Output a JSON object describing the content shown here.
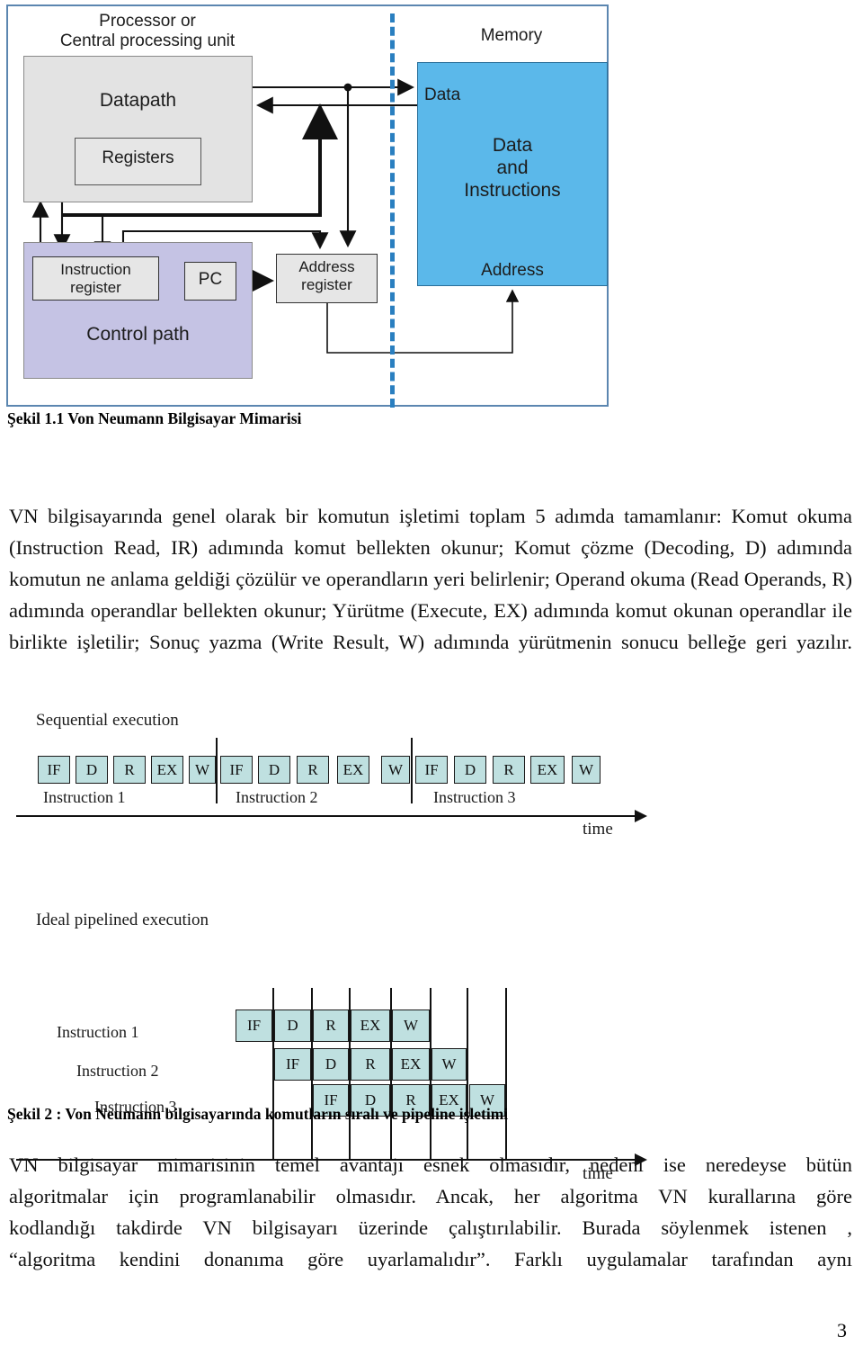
{
  "figure1": {
    "cpu_title": "Processor or\nCentral processing unit",
    "memory_title": "Memory",
    "datapath_label": "Datapath",
    "registers_label": "Registers",
    "control_path_label": "Control path",
    "instruction_register_label": "Instruction\nregister",
    "pc_label": "PC",
    "address_register_label": "Address\nregister",
    "memory_data_label": "Data",
    "memory_data_and_instructions_label": "Data\nand\nInstructions",
    "memory_address_label": "Address",
    "colors": {
      "frame_border": "#5b86b0",
      "datapath_fill": "#e3e3e3",
      "control_path_fill": "#c5c3e4",
      "memory_fill": "#5bb8ea",
      "divider": "#2a7fc0"
    },
    "caption": "Şekil 1.1 Von Neumann Bilgisayar Mimarisi"
  },
  "paragraph1": "VN bilgisayarında genel olarak bir komutun işletimi toplam 5 adımda tamamlanır: Komut okuma (Instruction Read, IR) adımında komut bellekten okunur;  Komut çözme (Decoding, D) adımında komutun ne anlama geldiği çözülür ve operandların yeri belirlenir; Operand okuma (Read Operands, R) adımında operandlar bellekten okunur; Yürütme (Execute, EX) adımında komut okunan operandlar ile birlikte işletilir; Sonuç yazma (Write Result, W) adımında yürütmenin sonucu belleğe geri yazılır.",
  "figure2": {
    "sequential_title": "Sequential execution",
    "pipelined_title": "Ideal pipelined execution",
    "time_label": "time",
    "stages": [
      "IF",
      "D",
      "R",
      "EX",
      "W"
    ],
    "instruction_labels": [
      "Instruction 1",
      "Instruction 2",
      "Instruction 3"
    ],
    "cell_color": "#bfe0e0",
    "caption": "Şekil 2 : Von Neumann bilgisayarında komutların sıralı ve pipeline işletimi"
  },
  "paragraph2": {
    "lines": [
      "VN  bilgisayar  mimarisinin  temel  avantajı  esnek  olmasıdır,  nedeni  ise  neredeyse  bütün",
      "algoritmalar  için  programlanabilir  olmasıdır.    Ancak,  her  algoritma  VN  kurallarına  göre",
      "kodlandığı  takdirde  VN  bilgisayarı  üzerinde  çalıştırılabilir.  Burada  söylenmek  istenen ,",
      "“algoritma  kendini  donanıma  göre  uyarlamalıdır”.  Farklı  uygulamalar  tarafından  aynı"
    ]
  },
  "page_number": "3"
}
